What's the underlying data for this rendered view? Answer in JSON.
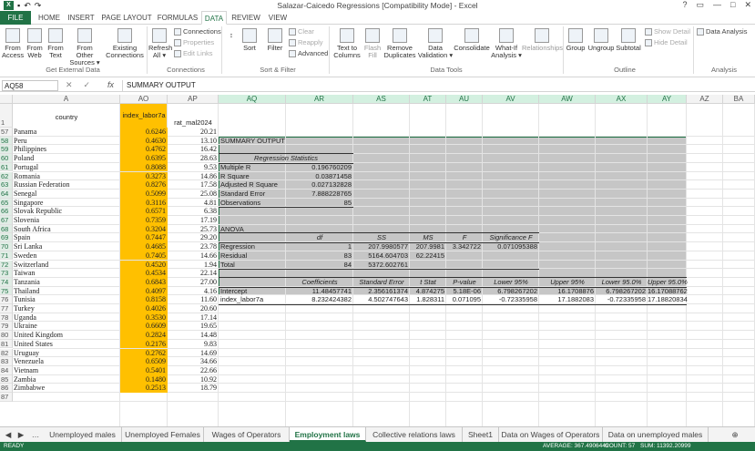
{
  "window": {
    "title": "Salazar-Caicedo Regressions  [Compatibility Mode] - Excel",
    "controls": [
      "?",
      "▭",
      "—",
      "□",
      "✕"
    ]
  },
  "ribbon_tabs": [
    "FILE",
    "HOME",
    "INSERT",
    "PAGE LAYOUT",
    "FORMULAS",
    "DATA",
    "REVIEW",
    "VIEW"
  ],
  "ribbon": {
    "get_external": {
      "buttons": [
        "From Access",
        "From Web",
        "From Text",
        "From Other Sources ▾",
        "Existing Connections"
      ],
      "label": "Get External Data"
    },
    "connections": {
      "refresh": "Refresh All ▾",
      "small": [
        "Connections",
        "Properties",
        "Edit Links"
      ],
      "label": "Connections"
    },
    "sort_filter": {
      "sort": "Sort",
      "filter": "Filter",
      "small": [
        "Clear",
        "Reapply",
        "Advanced"
      ],
      "label": "Sort & Filter"
    },
    "data_tools": {
      "buttons": [
        "Text to Columns",
        "Flash Fill",
        "Remove Duplicates",
        "Data Validation ▾",
        "Consolidate",
        "What-If Analysis ▾",
        "Relationships"
      ],
      "label": "Data Tools"
    },
    "outline": {
      "buttons": [
        "Group",
        "Ungroup",
        "Subtotal"
      ],
      "small": [
        "Show Detail",
        "Hide Detail"
      ],
      "label": "Outline"
    },
    "analysis": {
      "button": "Data Analysis",
      "label": "Analysis"
    }
  },
  "formula_bar": {
    "name_box": "AQ58",
    "fx": "fx",
    "content": "SUMMARY OUTPUT"
  },
  "columns": [
    "A",
    "AO",
    "AP",
    "AQ",
    "AR",
    "AS",
    "AT",
    "AU",
    "AV",
    "AW",
    "AX",
    "AY",
    "AZ",
    "BA"
  ],
  "header_row": {
    "row": "1",
    "A": "country",
    "AO": "index_labor7a",
    "AP": "rat_mal2024"
  },
  "rows": [
    {
      "r": "57",
      "c": "Panama",
      "ao": "0.6246",
      "ap": "20.21"
    },
    {
      "r": "58",
      "c": "Peru",
      "ao": "0.4630",
      "ap": "13.10"
    },
    {
      "r": "59",
      "c": "Philippines",
      "ao": "0.4762",
      "ap": "16.42"
    },
    {
      "r": "60",
      "c": "Poland",
      "ao": "0.6395",
      "ap": "28.63"
    },
    {
      "r": "61",
      "c": "Portugal",
      "ao": "0.8088",
      "ap": "9.53"
    },
    {
      "r": "62",
      "c": "Romania",
      "ao": "0.3273",
      "ap": "14.86"
    },
    {
      "r": "63",
      "c": "Russian Federation",
      "ao": "0.8276",
      "ap": "17.58"
    },
    {
      "r": "64",
      "c": "Senegal",
      "ao": "0.5099",
      "ap": "25.08"
    },
    {
      "r": "65",
      "c": "Singapore",
      "ao": "0.3116",
      "ap": "4.81"
    },
    {
      "r": "66",
      "c": "Slovak Republic",
      "ao": "0.6571",
      "ap": "6.38"
    },
    {
      "r": "67",
      "c": "Slovenia",
      "ao": "0.7359",
      "ap": "17.19"
    },
    {
      "r": "68",
      "c": "South Africa",
      "ao": "0.3204",
      "ap": "25.73"
    },
    {
      "r": "69",
      "c": "Spain",
      "ao": "0.7447",
      "ap": "29.20"
    },
    {
      "r": "70",
      "c": "Sri Lanka",
      "ao": "0.4685",
      "ap": "23.78"
    },
    {
      "r": "71",
      "c": "Sweden",
      "ao": "0.7405",
      "ap": "14.66"
    },
    {
      "r": "72",
      "c": "Switzerland",
      "ao": "0.4520",
      "ap": "1.94"
    },
    {
      "r": "73",
      "c": "Taiwan",
      "ao": "0.4534",
      "ap": "22.14"
    },
    {
      "r": "74",
      "c": "Tanzania",
      "ao": "0.6843",
      "ap": "27.00"
    },
    {
      "r": "75",
      "c": "Thailand",
      "ao": "0.4097",
      "ap": "4.16"
    },
    {
      "r": "76",
      "c": "Tunisia",
      "ao": "0.8158",
      "ap": "11.60"
    },
    {
      "r": "77",
      "c": "Turkey",
      "ao": "0.4026",
      "ap": "20.60"
    },
    {
      "r": "78",
      "c": "Uganda",
      "ao": "0.3530",
      "ap": "17.14"
    },
    {
      "r": "79",
      "c": "Ukraine",
      "ao": "0.6609",
      "ap": "19.65"
    },
    {
      "r": "80",
      "c": "United Kingdom",
      "ao": "0.2824",
      "ap": "14.48"
    },
    {
      "r": "81",
      "c": "United States",
      "ao": "0.2176",
      "ap": "9.83"
    },
    {
      "r": "82",
      "c": "Uruguay",
      "ao": "0.2762",
      "ap": "14.69"
    },
    {
      "r": "83",
      "c": "Venezuela",
      "ao": "0.6509",
      "ap": "34.66"
    },
    {
      "r": "84",
      "c": "Vietnam",
      "ao": "0.5401",
      "ap": "22.66"
    },
    {
      "r": "85",
      "c": "Zambia",
      "ao": "0.1480",
      "ap": "10.92"
    },
    {
      "r": "86",
      "c": "Zimbabwe",
      "ao": "0.2513",
      "ap": "18.79"
    },
    {
      "r": "87",
      "c": "",
      "ao": "",
      "ap": ""
    }
  ],
  "regression": {
    "summary_title": "SUMMARY OUTPUT",
    "stats_title": "Regression Statistics",
    "stats": [
      {
        "label": "Multiple R",
        "value": "0.196760209"
      },
      {
        "label": "R Square",
        "value": "0.03871458"
      },
      {
        "label": "Adjusted R Square",
        "value": "0.027132828"
      },
      {
        "label": "Standard Error",
        "value": "7.888228765"
      },
      {
        "label": "Observations",
        "value": "85"
      }
    ],
    "anova_title": "ANOVA",
    "anova_headers": [
      "df",
      "SS",
      "MS",
      "F",
      "Significance F"
    ],
    "anova_rows": [
      {
        "label": "Regression",
        "df": "1",
        "ss": "207.9980577",
        "ms": "207.9981",
        "f": "3.342722",
        "sig": "0.071095388"
      },
      {
        "label": "Residual",
        "df": "83",
        "ss": "5164.604703",
        "ms": "62.22415",
        "f": "",
        "sig": ""
      },
      {
        "label": "Total",
        "df": "84",
        "ss": "5372.602761",
        "ms": "",
        "f": "",
        "sig": ""
      }
    ],
    "coef_headers": [
      "Coefficients",
      "Standard Error",
      "t Stat",
      "P-value",
      "Lower 95%",
      "Upper 95%",
      "Lower 95.0%",
      "Upper 95.0%"
    ],
    "coef_rows": [
      {
        "label": "Intercept",
        "v": [
          "11.48457741",
          "2.356161374",
          "4.874275",
          "5.18E-06",
          "6.798267202",
          "16.1708876",
          "6.798267202",
          "16.17088762"
        ]
      },
      {
        "label": "index_labor7a",
        "v": [
          "8.232424382",
          "4.502747643",
          "1.828311",
          "0.071095",
          "-0.72335958",
          "17.1882083",
          "-0.72335958",
          "17.18820834"
        ]
      }
    ]
  },
  "sheet_tabs": [
    "Unemployed males",
    "Unemployed Females",
    "Wages of Operators",
    "Employment laws",
    "Collective relations laws",
    "Sheet1",
    "Data on Wages of Operators",
    "Data on unemployed males"
  ],
  "active_sheet": "Employment laws",
  "status": {
    "ready": "READY",
    "average": "AVERAGE: 367.4906449",
    "count": "COUNT: 57",
    "sum": "SUM: 11392.20999"
  },
  "colors": {
    "accent": "#217346",
    "highlight": "#ffc000",
    "selection": "#c6c6c6"
  }
}
